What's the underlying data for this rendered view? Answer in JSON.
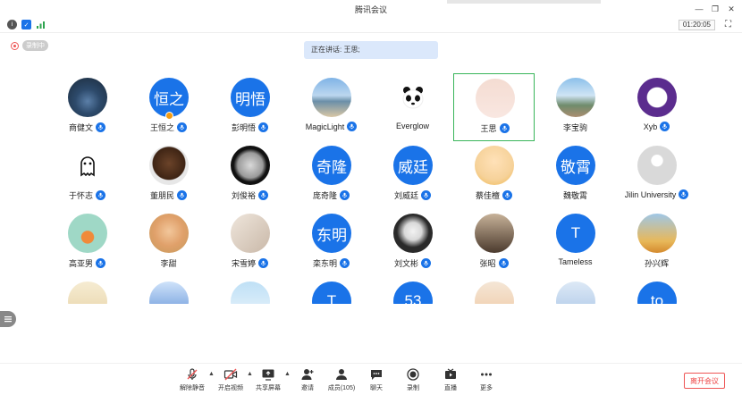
{
  "window": {
    "title": "腾讯会议"
  },
  "toolbar_top": {
    "timer": "01:20:05",
    "rec_label": "录制中"
  },
  "speaking_banner": "正在讲话: 王思;",
  "participants": [
    {
      "name": "商健文",
      "avatar": "photo-lake",
      "mic": true
    },
    {
      "name": "王恒之",
      "avatar_text": "恒之",
      "mic": true,
      "host": true
    },
    {
      "name": "彭明悟",
      "avatar_text": "明悟",
      "mic": true
    },
    {
      "name": "MagicLight",
      "avatar": "photo-beach",
      "mic": true
    },
    {
      "name": "Everglow",
      "avatar": "photo-panda",
      "mic": false
    },
    {
      "name": "王思",
      "avatar": "photo-baby",
      "mic": true,
      "active": true
    },
    {
      "name": "李宝驹",
      "avatar": "photo-building",
      "mic": false
    },
    {
      "name": "Xyb",
      "avatar": "photo-seal",
      "mic": true
    },
    {
      "name": "于怀志",
      "avatar": "photo-ghost",
      "mic": true
    },
    {
      "name": "董朋民",
      "avatar": "photo-face",
      "mic": true
    },
    {
      "name": "刘俊裕",
      "avatar": "photo-moon",
      "mic": true
    },
    {
      "name": "庞奇隆",
      "avatar_text": "奇隆",
      "mic": true
    },
    {
      "name": "刘威廷",
      "avatar_text": "威廷",
      "mic": true
    },
    {
      "name": "蔡佳檀",
      "avatar": "photo-cartoon-girl",
      "mic": true
    },
    {
      "name": "魏敬霄",
      "avatar_text": "敬霄",
      "mic": false
    },
    {
      "name": "Jilin University",
      "avatar": "photo-default",
      "mic": true
    },
    {
      "name": "高亚男",
      "avatar": "photo-carrot",
      "mic": true
    },
    {
      "name": "李甜",
      "avatar": "photo-child",
      "mic": false
    },
    {
      "name": "宋雪婷",
      "avatar": "photo-blur",
      "mic": true
    },
    {
      "name": "栾东明",
      "avatar_text": "东明",
      "mic": true
    },
    {
      "name": "刘文彬",
      "avatar": "photo-seal-dark",
      "mic": true
    },
    {
      "name": "张昭",
      "avatar": "photo-couple",
      "mic": true
    },
    {
      "name": "Tameless",
      "avatar_text": "T",
      "mic": false
    },
    {
      "name": "孙兴辉",
      "avatar": "photo-cat",
      "mic": false
    },
    {
      "name": "",
      "avatar": "photo-rabbit",
      "mic": false
    },
    {
      "name": "",
      "avatar": "photo-robot",
      "mic": false
    },
    {
      "name": "",
      "avatar": "photo-sky",
      "mic": false
    },
    {
      "name": "",
      "avatar_text": "T",
      "mic": false
    },
    {
      "name": "",
      "avatar_text": "53",
      "mic": false
    },
    {
      "name": "",
      "avatar": "photo-boy",
      "mic": false
    },
    {
      "name": "",
      "avatar": "photo-anime",
      "mic": false
    },
    {
      "name": "",
      "avatar_text": "to",
      "mic": false
    }
  ],
  "bottom_toolbar": {
    "unmute": "解除静音",
    "video": "开启视频",
    "share": "共享屏幕",
    "invite": "邀请",
    "members": "成员(105)",
    "chat": "聊天",
    "record": "录制",
    "live": "直播",
    "more": "更多",
    "leave": "离开会议"
  },
  "colors": {
    "accent": "#1a73e8",
    "active_border": "#39b55a",
    "danger": "#e55555"
  }
}
